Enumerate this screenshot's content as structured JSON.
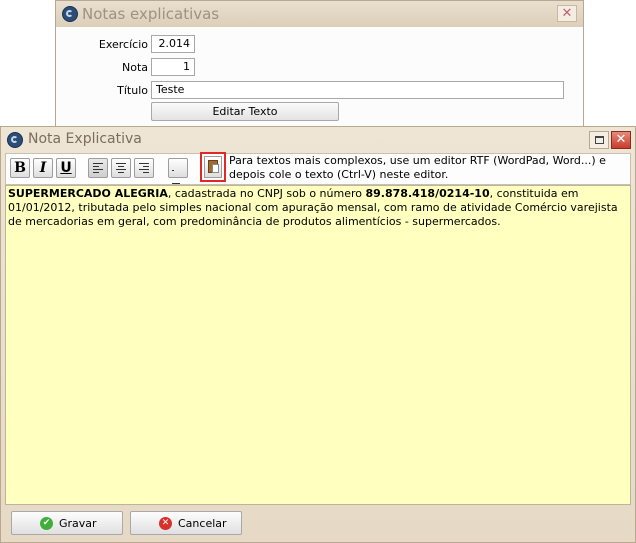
{
  "bg_window": {
    "title": "Notas explicativas",
    "close_glyph": "✕",
    "exercicio_label": "Exercício",
    "exercicio_value": "2.014",
    "nota_label": "Nota",
    "nota_value": "1",
    "titulo_label": "Título",
    "titulo_value": "Teste",
    "editar_button": "Editar Texto"
  },
  "main_window": {
    "title": "Nota Explicativa",
    "close_glyph": "✕"
  },
  "toolbar": {
    "bold": "B",
    "italic": "I",
    "underline": "U",
    "hint_text": "Para textos mais complexos, use um editor RTF (WordPad, Word...) e depois cole o texto (Ctrl-V) neste editor."
  },
  "editor": {
    "company": "SUPERMERCADO ALEGRIA",
    "text1": ", cadastrada no CNPJ sob o número ",
    "cnpj": "89.878.418/0214-10",
    "text2": ", constituida em 01/01/2012, tributada pelo simples nacional com apuração mensal, com ramo de atividade Comércio varejista de mercadorias em geral, com predominância de produtos alimentícios - supermercados."
  },
  "actions": {
    "gravar": "Gravar",
    "cancelar": "Cancelar",
    "gravar_icon": "✔",
    "cancelar_icon": "✕"
  },
  "colors": {
    "editor_bg": "#ffffc0",
    "window_frame": "#e6dac6",
    "highlight": "#e02828"
  }
}
